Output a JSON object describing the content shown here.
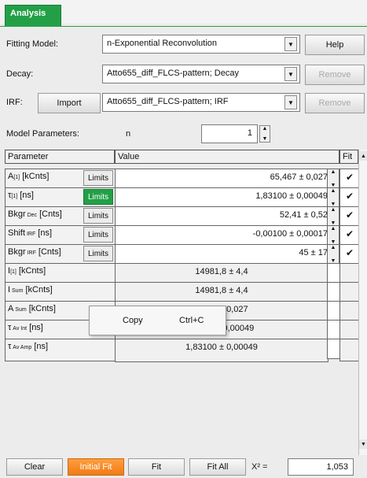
{
  "tab": {
    "label": "Analysis"
  },
  "fitting_model": {
    "label": "Fitting Model:",
    "value": "n-Exponential Reconvolution",
    "help_label": "Help"
  },
  "decay": {
    "label": "Decay:",
    "value": "Atto655_diff_FLCS-pattern; Decay",
    "remove_label": "Remove"
  },
  "irf": {
    "label": "IRF:",
    "import_label": "Import",
    "value": "Atto655_diff_FLCS-pattern; IRF",
    "remove_label": "Remove"
  },
  "model_params": {
    "label": "Model Parameters:",
    "n_label": "n",
    "n_value": "1"
  },
  "table": {
    "headers": {
      "parameter": "Parameter",
      "value": "Value",
      "fit": "Fit"
    },
    "limits_label": "Limits",
    "rows": [
      {
        "main": "A",
        "sub": "[1]",
        "unit": " [kCnts]",
        "value": "65,467 ± 0,027",
        "fit": "✔"
      },
      {
        "main": "τ",
        "sub": "[1]",
        "unit": " [ns]",
        "value": "1,83100 ± 0,00049",
        "fit": "✔"
      },
      {
        "main": "Bkgr",
        "sub": " Dec",
        "unit": " [Cnts]",
        "value": "52,41 ± 0,52",
        "fit": "✔"
      },
      {
        "main": "Shift",
        "sub": " IRF",
        "unit": " [ns]",
        "value": "-0,00100 ± 0,00017",
        "fit": "✔"
      },
      {
        "main": "Bkgr",
        "sub": " IRF",
        "unit": " [Cnts]",
        "value": "45 ± 17",
        "fit": "✔"
      },
      {
        "main": "I",
        "sub": "[1]",
        "unit": " [kCnts]",
        "value": "14981,8 ± 4,4",
        "fit": ""
      },
      {
        "main": "I",
        "sub": " Sum",
        "unit": " [kCnts]",
        "value": "14981,8 ± 4,4",
        "fit": ""
      },
      {
        "main": "A",
        "sub": " Sum",
        "unit": " [kCnts]",
        "value": "5,467 ± 0,027",
        "fit": ""
      },
      {
        "main": "τ",
        "sub": " Av Int",
        "unit": " [ns]",
        "value": "83100 ± 0,00049",
        "fit": ""
      },
      {
        "main": "τ",
        "sub": " Av Amp",
        "unit": " [ns]",
        "value": "1,83100 ± 0,00049",
        "fit": ""
      }
    ]
  },
  "context_menu": {
    "copy_label": "Copy",
    "shortcut": "Ctrl+C"
  },
  "bottom": {
    "clear_label": "Clear",
    "initial_fit_label": "Initial Fit",
    "fit_label": "Fit",
    "fit_all_label": "Fit All",
    "chi_label": "X² =",
    "chi_value": "1,053"
  },
  "colors": {
    "accent_green": "#23a047",
    "accent_orange": "#f07b16"
  }
}
